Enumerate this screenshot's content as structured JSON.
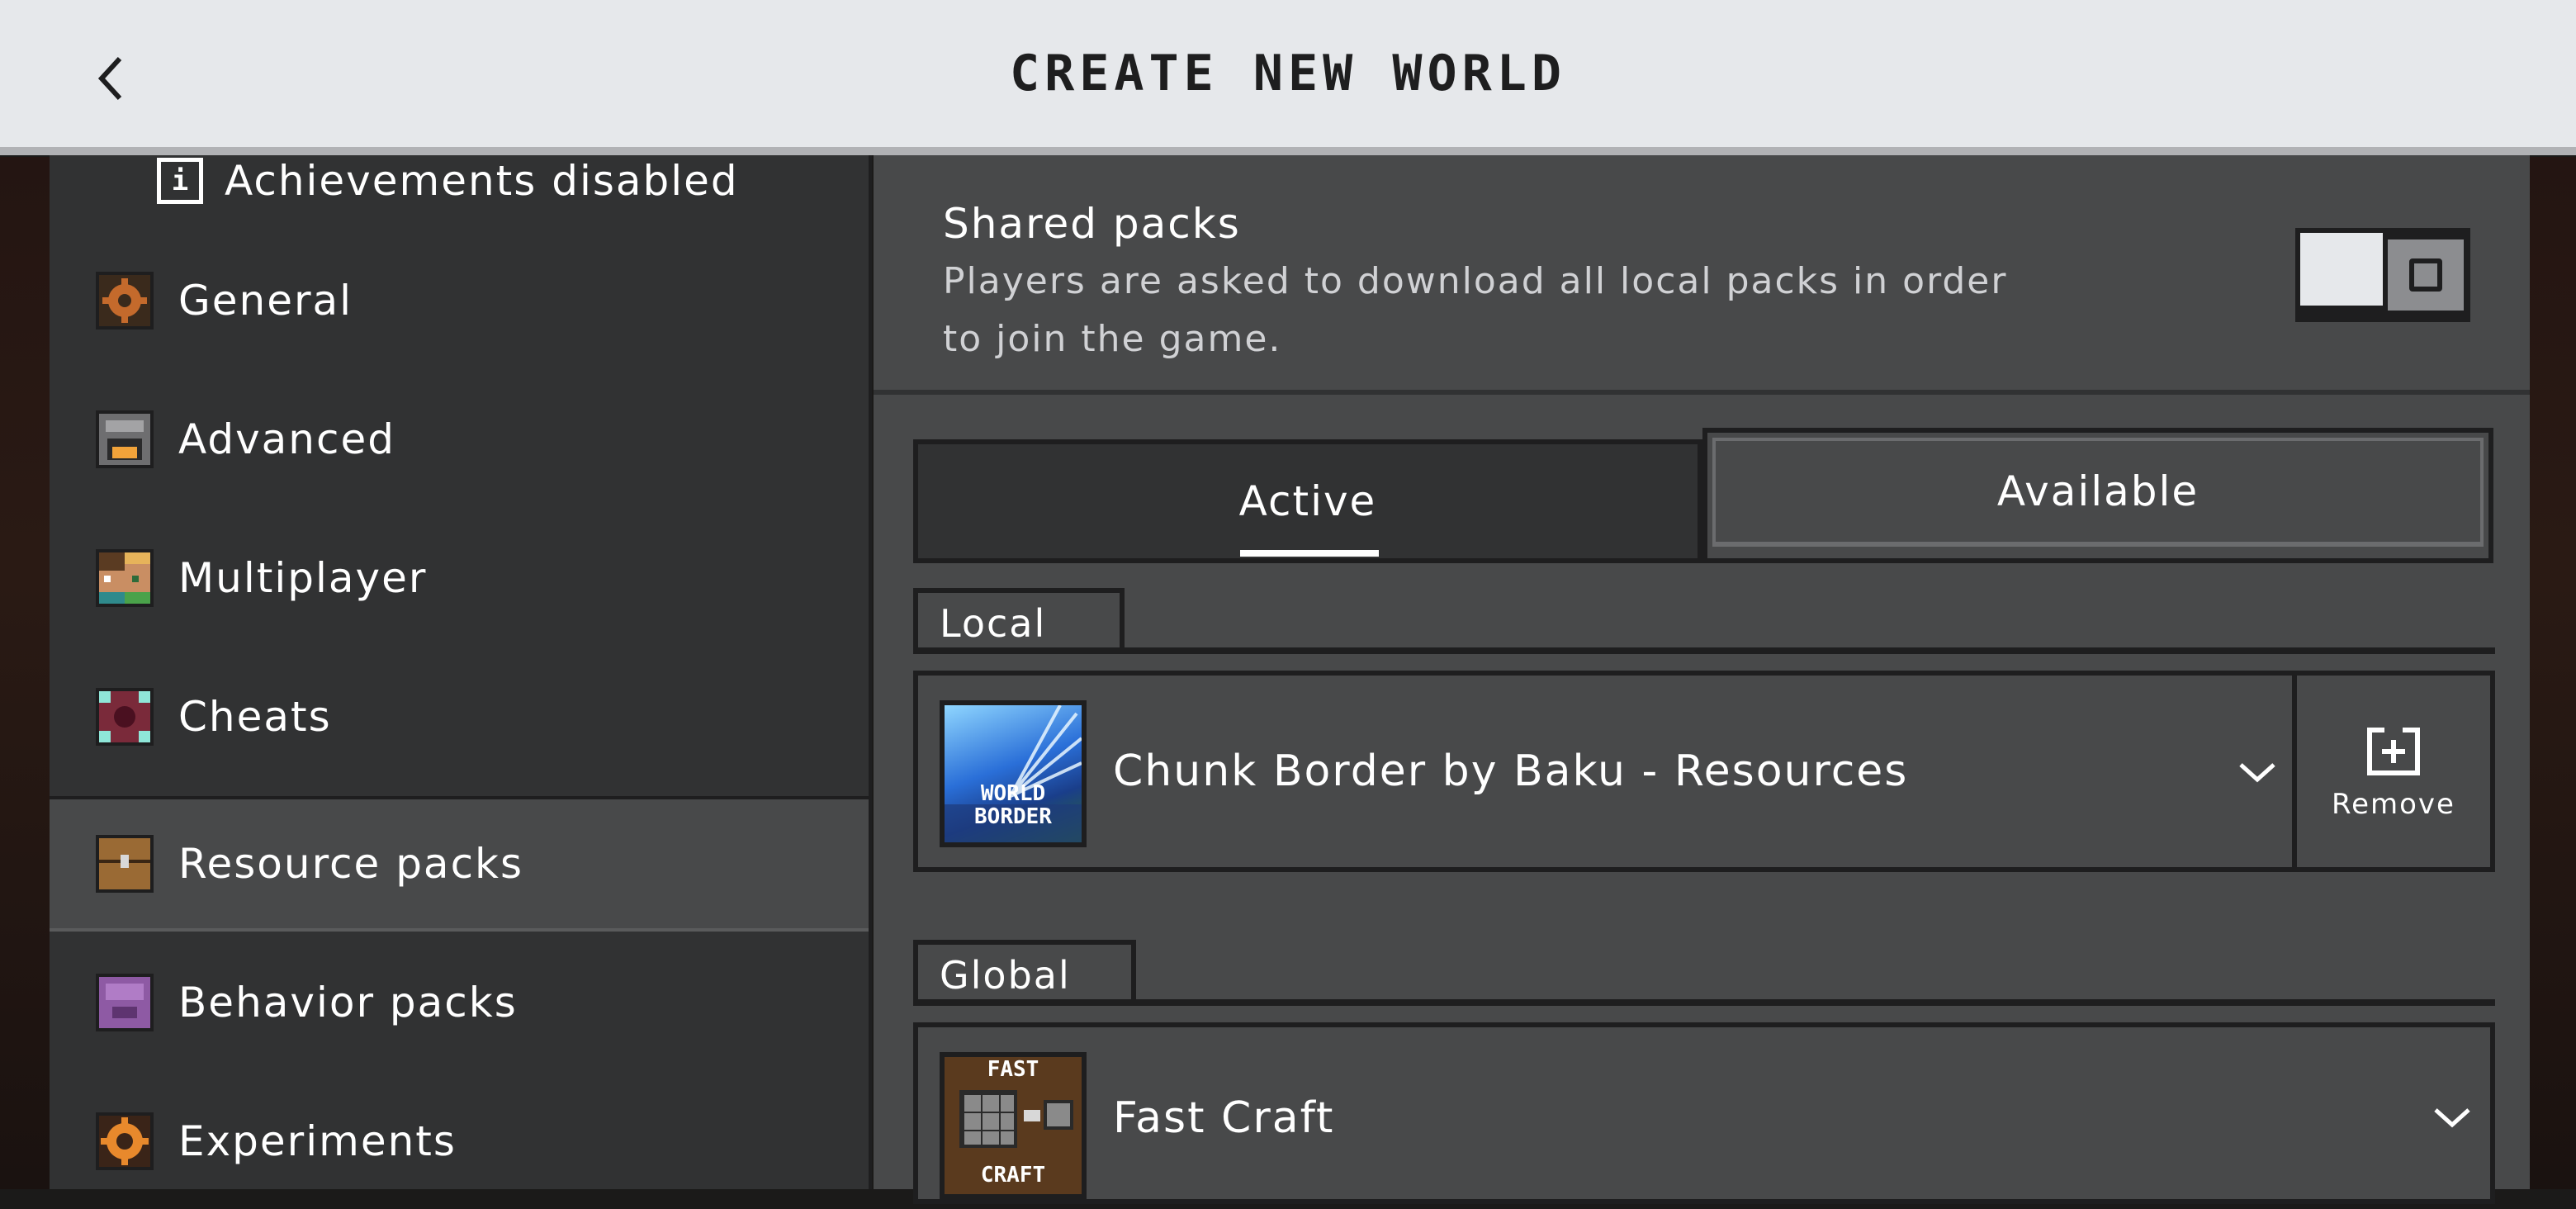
{
  "header": {
    "title": "CREATE NEW WORLD",
    "back_icon": "chevron-left-icon"
  },
  "sidebar": {
    "achievements_notice": "Achievements disabled",
    "info_icon_glyph": "i",
    "items": [
      {
        "label": "General",
        "icon": "gear-icon",
        "selected": false
      },
      {
        "label": "Advanced",
        "icon": "furnace-icon",
        "selected": false
      },
      {
        "label": "Multiplayer",
        "icon": "players-icon",
        "selected": false
      },
      {
        "label": "Cheats",
        "icon": "command-block-icon",
        "selected": false
      },
      {
        "label": "Resource packs",
        "icon": "chest-icon",
        "selected": true
      },
      {
        "label": "Behavior packs",
        "icon": "purple-block-icon",
        "selected": false
      },
      {
        "label": "Experiments",
        "icon": "experiments-icon",
        "selected": false
      }
    ]
  },
  "main": {
    "shared_packs": {
      "title": "Shared packs",
      "description": "Players are asked to download all local packs in order to join the game.",
      "toggle_on": false
    },
    "tabs": [
      {
        "label": "Active",
        "selected": true
      },
      {
        "label": "Available",
        "selected": false
      }
    ],
    "local": {
      "section_label": "Local",
      "packs": [
        {
          "name": "Chunk Border by Baku - Resources",
          "thumb_text_1": "WORLD",
          "thumb_text_2": "BORDER",
          "remove_label": "Remove"
        }
      ]
    },
    "global": {
      "section_label": "Global",
      "packs": [
        {
          "name": "Fast Craft",
          "thumb_text_1": "FAST",
          "thumb_text_2": "CRAFT"
        }
      ]
    }
  },
  "colors": {
    "header_bg": "#e6e8eb",
    "sidebar_bg": "#313233",
    "panel_bg": "#48494a",
    "border": "#1e1e1f",
    "text": "#ffffff"
  }
}
